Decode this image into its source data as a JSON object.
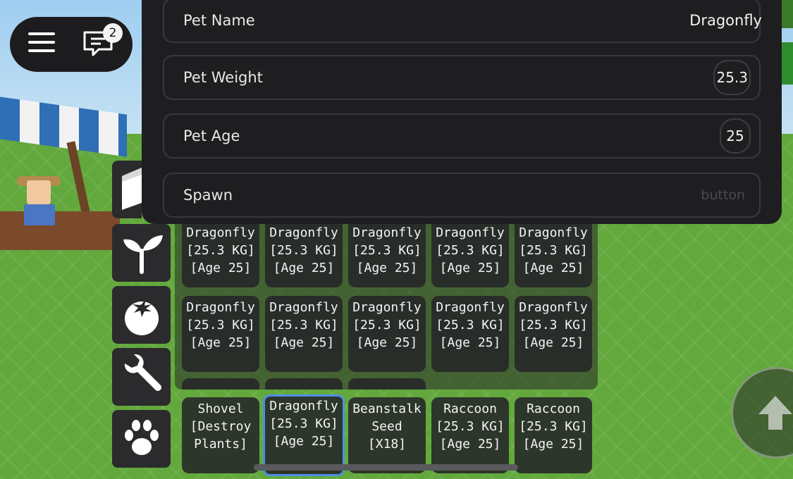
{
  "menu": {
    "notification_count": "2",
    "icons": [
      "hamburger-icon",
      "chat-icon"
    ]
  },
  "side_categories": [
    {
      "name": "cube-icon"
    },
    {
      "name": "sprout-icon"
    },
    {
      "name": "tomato-icon"
    },
    {
      "name": "wrench-icon"
    },
    {
      "name": "paw-icon"
    }
  ],
  "panel": {
    "pet_name_label": "Pet Name",
    "pet_name_value": "Dragonfly",
    "pet_weight_label": "Pet Weight",
    "pet_weight_value": "25.3",
    "pet_age_label": "Pet Age",
    "pet_age_value": "25",
    "spawn_label": "Spawn",
    "spawn_hint": "button"
  },
  "inventory_rows": [
    [
      [
        "Dragonfly",
        "[25.3 KG]",
        "[Age 25]"
      ],
      [
        "Dragonfly",
        "[25.3 KG]",
        "[Age 25]"
      ],
      [
        "Dragonfly",
        "[25.3 KG]",
        "[Age 25]"
      ],
      [
        "Dragonfly",
        "[25.3 KG]",
        "[Age 25]"
      ],
      [
        "Dragonfly",
        "[25.3 KG]",
        "[Age 25]"
      ]
    ],
    [
      [
        "Dragonfly",
        "[25.3 KG]",
        "[Age 25]"
      ],
      [
        "Dragonfly",
        "[25.3 KG]",
        "[Age 25]"
      ],
      [
        "Dragonfly",
        "[25.3 KG]",
        "[Age 25]"
      ],
      [
        "Dragonfly",
        "[25.3 KG]",
        "[Age 25]"
      ],
      [
        "Dragonfly",
        "[25.3 KG]",
        "[Age 25]"
      ]
    ]
  ],
  "hotbar": [
    [
      "Shovel",
      "[Destroy",
      "Plants]"
    ],
    [
      "Dragonfly",
      "[25.3 KG]",
      "[Age 25]"
    ],
    [
      "Beanstalk",
      "Seed",
      "[X18]"
    ],
    [
      "Raccoon",
      "[25.3 KG]",
      "[Age 25]"
    ],
    [
      "Raccoon",
      "[25.3 KG]",
      "[Age 25]"
    ]
  ],
  "colors": {
    "panel_bg": "#1e1e21",
    "selected_border": "#4d8fe6",
    "grass": "#62a83c"
  }
}
